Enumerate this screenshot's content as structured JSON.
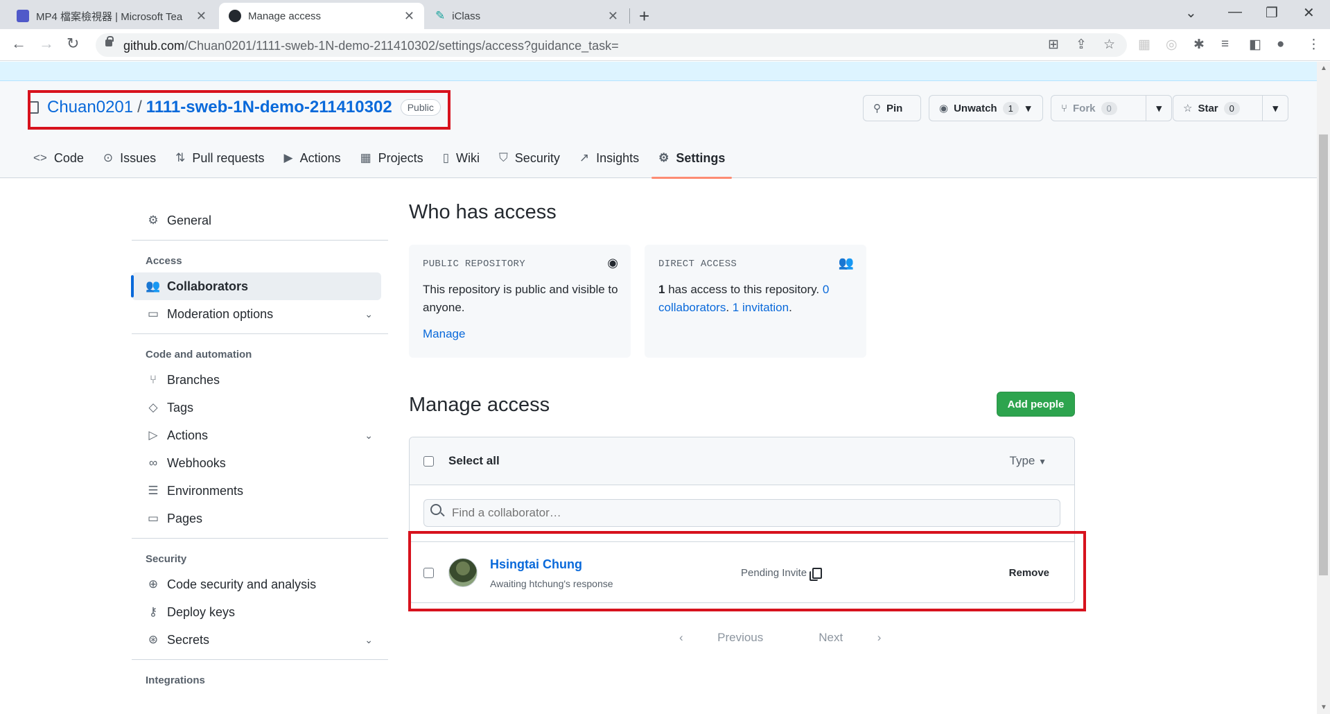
{
  "browser": {
    "tabs": [
      {
        "title": "MP4 檔案檢視器 | Microsoft Tea",
        "icon": "teams-icon",
        "active": false
      },
      {
        "title": "Manage access",
        "icon": "github-icon",
        "active": true
      },
      {
        "title": "iClass",
        "icon": "iclass-icon",
        "active": false
      }
    ],
    "url_host": "github.com",
    "url_path": "/Chuan0201/1111-sweb-1N-demo-211410302/settings/access?guidance_task="
  },
  "repo": {
    "owner": "Chuan0201",
    "separator": "/",
    "name": "1111-sweb-1N-demo-211410302",
    "visibility": "Public",
    "buttons": {
      "pin": "Pin",
      "unwatch": "Unwatch",
      "unwatch_count": "1",
      "fork": "Fork",
      "fork_count": "0",
      "star": "Star",
      "star_count": "0"
    },
    "nav": [
      {
        "label": "Code",
        "icon": "code-icon"
      },
      {
        "label": "Issues",
        "icon": "issue-icon"
      },
      {
        "label": "Pull requests",
        "icon": "pull-request-icon"
      },
      {
        "label": "Actions",
        "icon": "play-icon"
      },
      {
        "label": "Projects",
        "icon": "table-icon"
      },
      {
        "label": "Wiki",
        "icon": "book-icon"
      },
      {
        "label": "Security",
        "icon": "shield-icon"
      },
      {
        "label": "Insights",
        "icon": "graph-icon"
      },
      {
        "label": "Settings",
        "icon": "gear-icon",
        "selected": true
      }
    ]
  },
  "sidebar": {
    "general": "General",
    "access_heading": "Access",
    "collaborators": "Collaborators",
    "moderation": "Moderation options",
    "code_heading": "Code and automation",
    "branches": "Branches",
    "tags": "Tags",
    "actions": "Actions",
    "webhooks": "Webhooks",
    "environments": "Environments",
    "pages": "Pages",
    "security_heading": "Security",
    "code_security": "Code security and analysis",
    "deploy_keys": "Deploy keys",
    "secrets": "Secrets",
    "integrations_heading": "Integrations"
  },
  "main": {
    "who_title": "Who has access",
    "public_box": {
      "label": "PUBLIC REPOSITORY",
      "text": "This repository is public and visible to anyone.",
      "link": "Manage"
    },
    "direct_box": {
      "label": "DIRECT ACCESS",
      "count": "1",
      "text": " has access to this repository. ",
      "collaborators_link": "0 collaborators",
      "dot": ". ",
      "invitation_link": "1 invitation",
      "end": "."
    },
    "manage_title": "Manage access",
    "add_people": "Add people",
    "select_all": "Select all",
    "type_filter": "Type",
    "search_placeholder": "Find a collaborator…",
    "collaborator": {
      "name": "Hsingtai Chung",
      "subtitle": "Awaiting htchung's response",
      "status": "Pending Invite",
      "remove": "Remove"
    },
    "pager": {
      "previous": "Previous",
      "next": "Next"
    }
  },
  "colors": {
    "accent": "#0969da",
    "highlight": "#d7121d",
    "primary_button": "#2da44e"
  }
}
